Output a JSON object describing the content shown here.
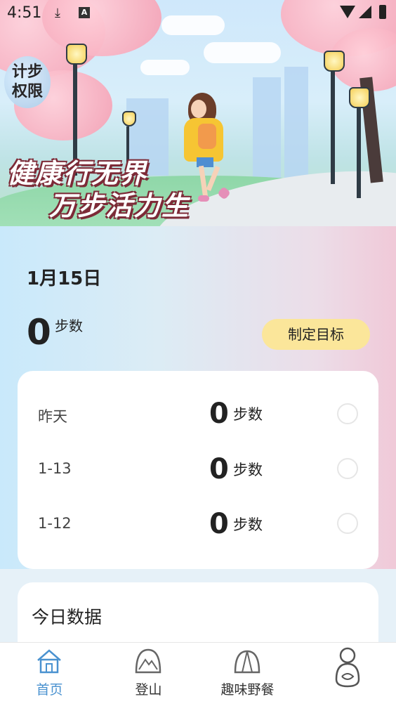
{
  "status_bar": {
    "time": "4:51"
  },
  "banner": {
    "badge_line1": "计步",
    "badge_line2": "权限",
    "slogan_line1": "健康行无界",
    "slogan_line2": "万步活力生"
  },
  "today": {
    "date": "1月15日",
    "steps": "0",
    "unit": "步数",
    "goal_button": "制定目标"
  },
  "history": [
    {
      "label": "昨天",
      "steps": "0",
      "unit": "步数"
    },
    {
      "label": "1-13",
      "steps": "0",
      "unit": "步数"
    },
    {
      "label": "1-12",
      "steps": "0",
      "unit": "步数"
    }
  ],
  "today_data": {
    "title": "今日数据"
  },
  "nav": {
    "items": [
      {
        "label": "首页",
        "icon": "home-icon",
        "active": true
      },
      {
        "label": "登山",
        "icon": "mountain-icon",
        "active": false
      },
      {
        "label": "趣味野餐",
        "icon": "tent-icon",
        "active": false
      },
      {
        "label": "",
        "icon": "profile-icon",
        "active": false
      }
    ]
  },
  "colors": {
    "accent": "#4a92d0",
    "goal_button": "#fbe69a"
  }
}
